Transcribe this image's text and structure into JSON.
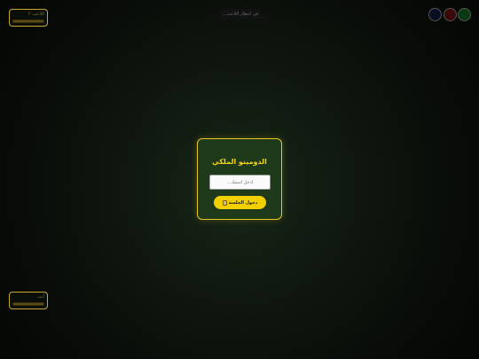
{
  "players": {
    "top": {
      "name": "اللاعب ٢"
    },
    "bottom": {
      "name": "أنت"
    }
  },
  "status": {
    "text": "في انتظار اللاعب..."
  },
  "login": {
    "title": "الدومينو الملكي",
    "input_placeholder": "ادخل اسمك...",
    "enter_label": "دخول الجلسة"
  },
  "colors": {
    "accent": "#f2d000",
    "panel": "#1e3a1a"
  }
}
